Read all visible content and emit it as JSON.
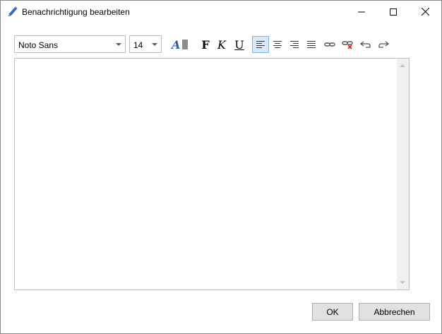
{
  "window": {
    "title": "Benachrichtigung bearbeiten"
  },
  "toolbar": {
    "font_family": "Noto Sans",
    "font_size": "14",
    "bold_label": "F",
    "italic_label": "K",
    "underline_label": "U",
    "active_alignment": "align-left"
  },
  "editor": {
    "content": ""
  },
  "buttons": {
    "ok": "OK",
    "cancel": "Abbrechen"
  },
  "colors": {
    "accent": "#7eb4ea",
    "active_bg": "#d9e8f7",
    "icon_blue": "#2f5d9e"
  }
}
